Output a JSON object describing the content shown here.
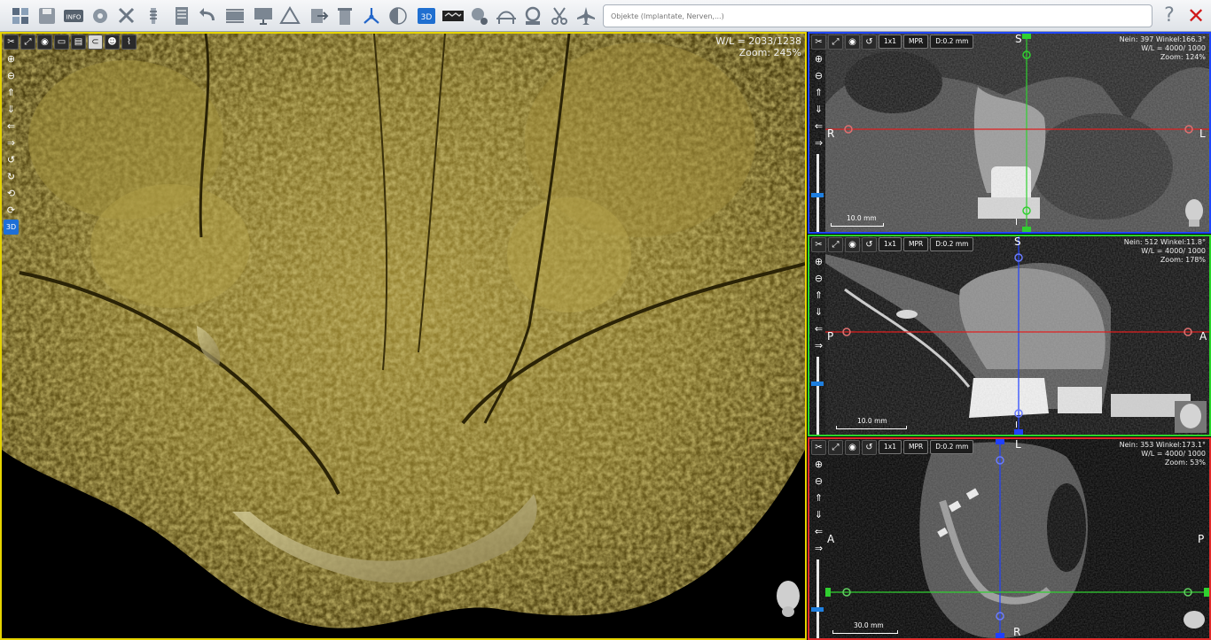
{
  "toolbar": {
    "search_placeholder": "Objekte (Implantate, Nerven,...)",
    "help_label": "?",
    "close_label": "✕",
    "buttons": [
      {
        "icon": "layout-icon"
      },
      {
        "icon": "save-icon"
      },
      {
        "icon": "info-icon"
      },
      {
        "icon": "settings-icon"
      },
      {
        "icon": "tools-icon"
      },
      {
        "icon": "implant-icon"
      },
      {
        "icon": "report-icon"
      },
      {
        "icon": "undo-icon"
      },
      {
        "icon": "panorama-icon"
      },
      {
        "icon": "screen-icon"
      },
      {
        "icon": "measure-icon"
      },
      {
        "icon": "export-icon"
      },
      {
        "icon": "delete-icon"
      },
      {
        "icon": "axes-icon"
      },
      {
        "icon": "contrast-icon"
      },
      {
        "icon": "3d-icon"
      },
      {
        "icon": "pano-view-icon"
      },
      {
        "icon": "nerve-settings-icon"
      },
      {
        "icon": "bridge-icon"
      },
      {
        "icon": "ring-icon"
      },
      {
        "icon": "scissors-icon"
      },
      {
        "icon": "airplane-icon"
      }
    ]
  },
  "view3d": {
    "wl": "W/L = 2033/1238",
    "zoom": "Zoom: 245%",
    "side_tools": [
      "⊕",
      "⊖",
      "⇑",
      "⇓",
      "⇐",
      "⇒",
      "↺",
      "↻",
      "⟲",
      "⟳",
      "3D"
    ]
  },
  "coronal": {
    "btn_layout": "1x1",
    "btn_mpr": "MPR",
    "btn_depth": "D:0.2 mm",
    "info1": "Nein: 397 Winkel:166.3°",
    "info2": "W/L = 4000/ 1000",
    "info3": "Zoom: 124%",
    "label_top": "S",
    "label_left": "R",
    "label_right": "L",
    "label_bottom": "I",
    "scale_label": "10.0 mm"
  },
  "sagittal": {
    "btn_layout": "1x1",
    "btn_mpr": "MPR",
    "btn_depth": "D:0.2 mm",
    "info1": "Nein: 512 Winkel:11.8°",
    "info2": "W/L = 4000/ 1000",
    "info3": "Zoom: 178%",
    "label_top": "S",
    "label_left": "P",
    "label_right": "A",
    "label_bottom": "I",
    "scale_label": "10.0 mm"
  },
  "axial": {
    "btn_layout": "1x1",
    "btn_mpr": "MPR",
    "btn_depth": "D:0.2 mm",
    "info1": "Nein: 353 Winkel:173.1°",
    "info2": "W/L = 4000/ 1000",
    "info3": "Zoom: 53%",
    "label_top": "L",
    "label_left": "A",
    "label_right": "P",
    "label_bottom": "R",
    "scale_label": "30.0 mm"
  },
  "colors": {
    "view3d_border": "#e5d300",
    "coronal_border": "#1f46ff",
    "sagittal_border": "#2ad52a",
    "axial_border": "#e12a2a",
    "bone_tint": "#8a7a2c"
  }
}
